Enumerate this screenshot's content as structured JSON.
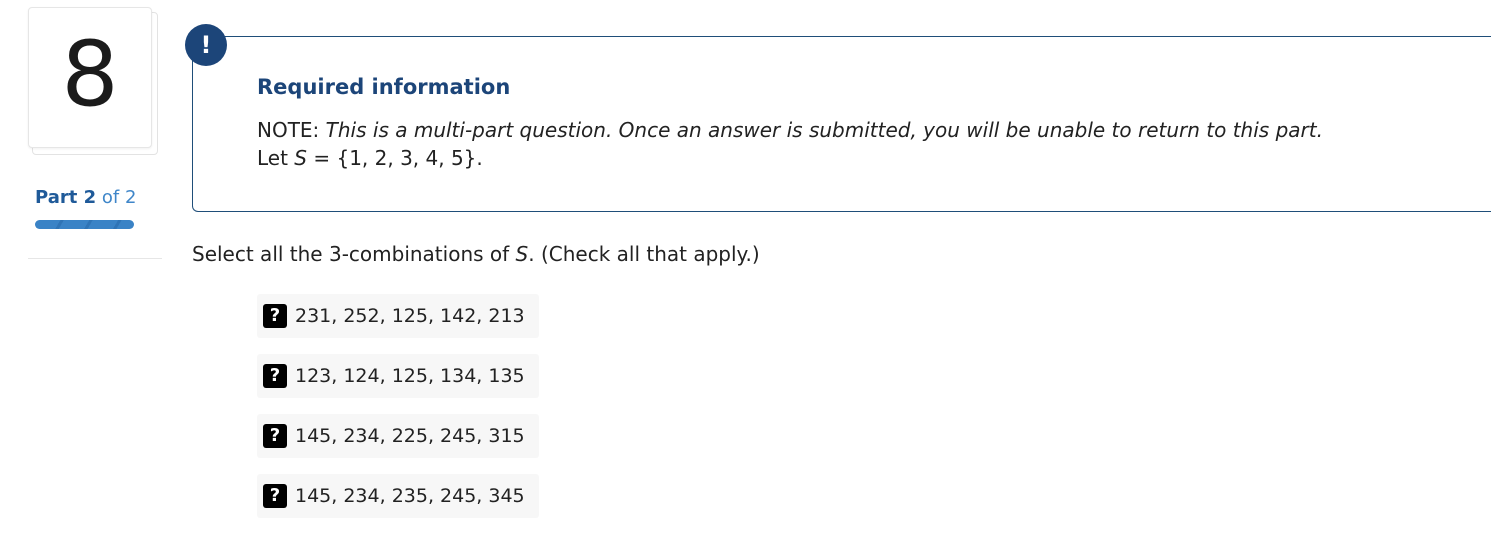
{
  "question_number": "8",
  "part": {
    "word": "Part",
    "current": "2",
    "of": "of",
    "total": "2",
    "progress": 1.0
  },
  "info": {
    "badge_glyph": "!",
    "title": "Required information",
    "note_label": "NOTE:",
    "note_text": "This is a multi-part question. Once an answer is submitted, you will be unable to return to this part.",
    "let_prefix": "Let ",
    "let_var": "S",
    "let_rest": " = {1, 2, 3, 4, 5}."
  },
  "question": {
    "prefix": "Select all the 3-combinations of ",
    "var": "S",
    "suffix": ". (Check all that apply.)"
  },
  "options": [
    {
      "icon": "?",
      "text": "231, 252, 125, 142, 213"
    },
    {
      "icon": "?",
      "text": "123, 124, 125, 134, 135"
    },
    {
      "icon": "?",
      "text": "145, 234, 225, 245, 315"
    },
    {
      "icon": "?",
      "text": "145, 234, 235, 245, 345"
    }
  ],
  "colors": {
    "navy": "#1c4579",
    "part_blue": "#2a78bd",
    "progress_blue": "#3a83c6",
    "option_bg": "#f7f7f7"
  }
}
